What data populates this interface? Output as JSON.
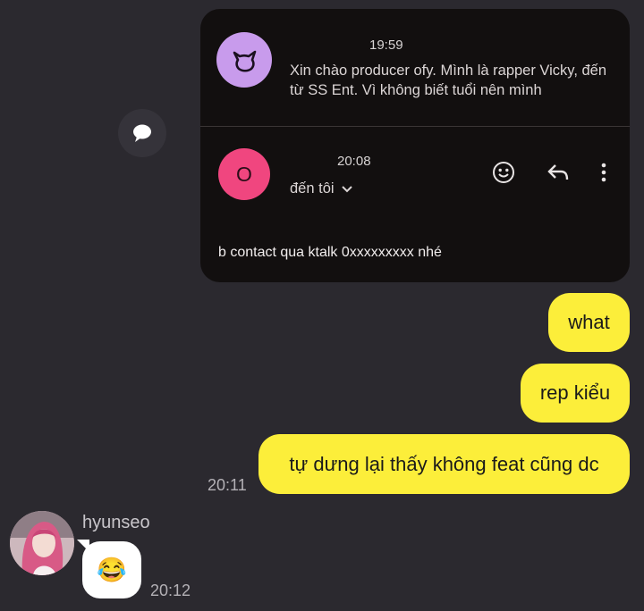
{
  "email_card": {
    "message1": {
      "time": "19:59",
      "preview": "Xin chào producer ofy. Mình là rapper Vicky, đến từ SS Ent. Vì không biết tuổi nên mình"
    },
    "message2": {
      "avatar_letter": "O",
      "time": "20:08",
      "recipient": "đến tôi",
      "body": "b contact qua ktalk 0xxxxxxxxx nhé",
      "icons": [
        "emoji-reaction-icon",
        "reply-icon",
        "more-options-icon"
      ]
    }
  },
  "chat": {
    "sent_messages": [
      {
        "text": "what"
      },
      {
        "text": "rep kiểu"
      },
      {
        "text": "tự dưng lại thấy không feat cũng dc"
      }
    ],
    "sent_time": "20:11",
    "received": {
      "username": "hyunseo",
      "emoji": "😂",
      "time": "20:12"
    }
  },
  "colors": {
    "background": "#2b292f",
    "card": "#120f0f",
    "bubble_yellow": "#fcee3a",
    "avatar_cat": "#c89bec",
    "avatar_o": "#f0467f"
  }
}
